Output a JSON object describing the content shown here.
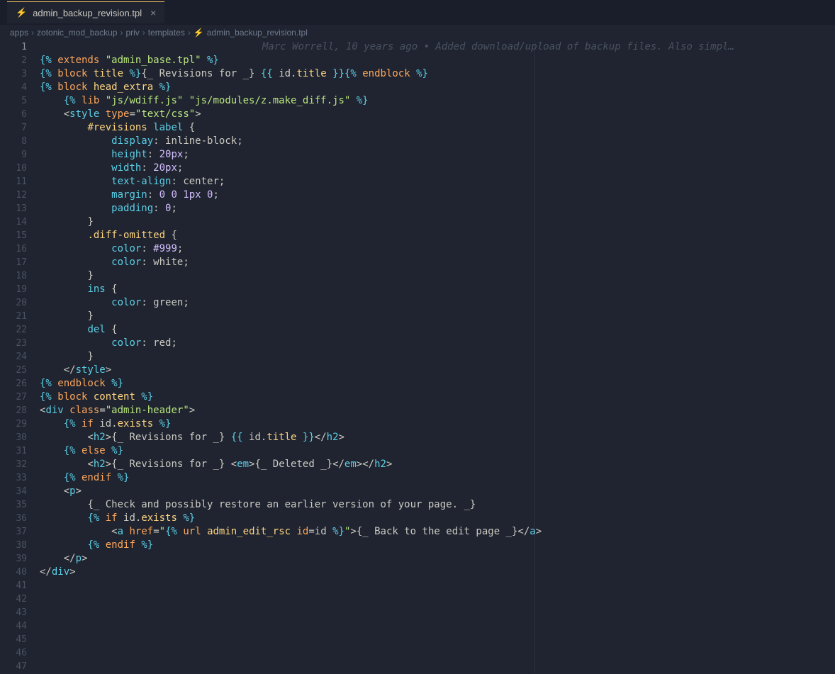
{
  "tab": {
    "filename": "admin_backup_revision.tpl"
  },
  "breadcrumbs": {
    "items": [
      "apps",
      "zotonic_mod_backup",
      "priv",
      "templates",
      "admin_backup_revision.tpl"
    ]
  },
  "blame": "Marc Worrell, 10 years ago • Added download/upload of backup files. Also simpl…",
  "lines": {
    "count": 47,
    "current": 1
  },
  "code": {
    "l1": {
      "p1": "{%",
      "p2": " extends ",
      "p3": "\"admin_base.tpl\"",
      "p4": " %}"
    },
    "l3": {
      "p1": "{%",
      "p2": " block",
      "p3": " title ",
      "p4": "%}",
      "p5": "{_ Revisions for _}",
      "p6": " {{ ",
      "p7": "id",
      "p8": ".",
      "p9": "title",
      "p10": " }}",
      "p11": "{%",
      "p12": " endblock ",
      "p13": "%}"
    },
    "l5": {
      "p1": "{%",
      "p2": " block",
      "p3": " head_extra ",
      "p4": "%}"
    },
    "l6": {
      "indent": "    ",
      "p1": "{%",
      "p2": " lib ",
      "p3": "\"js/wdiff.js\"",
      "p4": " ",
      "p5": "\"js/modules/z.make_diff.js\"",
      "p6": " %}"
    },
    "l8": {
      "indent": "    ",
      "p1": "<",
      "p2": "style",
      "p3": " type",
      "p4": "=",
      "p5": "\"text/css\"",
      "p6": ">"
    },
    "l9": {
      "indent": "        ",
      "p1": "#revisions",
      "p2": " label",
      "p3": " {"
    },
    "l10": {
      "indent": "            ",
      "p1": "display",
      "p2": ": ",
      "p3": "inline-block",
      "p4": ";"
    },
    "l11": {
      "indent": "            ",
      "p1": "height",
      "p2": ": ",
      "p3": "20px",
      "p4": ";"
    },
    "l12": {
      "indent": "            ",
      "p1": "width",
      "p2": ": ",
      "p3": "20px",
      "p4": ";"
    },
    "l13": {
      "indent": "            ",
      "p1": "text-align",
      "p2": ": ",
      "p3": "center",
      "p4": ";"
    },
    "l14": {
      "indent": "            ",
      "p1": "margin",
      "p2": ": ",
      "p3": "0 0 1px 0",
      "p4": ";"
    },
    "l15": {
      "indent": "            ",
      "p1": "padding",
      "p2": ": ",
      "p3": "0",
      "p4": ";"
    },
    "l16": {
      "indent": "        ",
      "p1": "}"
    },
    "l17": {
      "indent": "        ",
      "p1": ".diff-omitted",
      "p2": " {"
    },
    "l18": {
      "indent": "            ",
      "p1": "color",
      "p2": ": ",
      "p3": "#999",
      "p4": ";"
    },
    "l19": {
      "indent": "            ",
      "p1": "color",
      "p2": ": ",
      "p3": "white",
      "p4": ";"
    },
    "l20": {
      "indent": "        ",
      "p1": "}"
    },
    "l21": {
      "indent": "        ",
      "p1": "ins",
      "p2": " {"
    },
    "l22": {
      "indent": "            ",
      "p1": "color",
      "p2": ": ",
      "p3": "green",
      "p4": ";"
    },
    "l23": {
      "indent": "        ",
      "p1": "}"
    },
    "l24": {
      "indent": "        ",
      "p1": "del",
      "p2": " {"
    },
    "l25": {
      "indent": "            ",
      "p1": "color",
      "p2": ": ",
      "p3": "red",
      "p4": ";"
    },
    "l26": {
      "indent": "        ",
      "p1": "}"
    },
    "l27": {
      "indent": "    ",
      "p1": "</",
      "p2": "style",
      "p3": ">"
    },
    "l28": {
      "p1": "{%",
      "p2": " endblock ",
      "p3": "%}"
    },
    "l31": {
      "p1": "{%",
      "p2": " block",
      "p3": " content ",
      "p4": "%}"
    },
    "l33": {
      "p1": "<",
      "p2": "div",
      "p3": " class",
      "p4": "=",
      "p5": "\"admin-header\"",
      "p6": ">"
    },
    "l35": {
      "indent": "    ",
      "p1": "{%",
      "p2": " if",
      "p3": " id",
      "p4": ".",
      "p5": "exists",
      "p6": " %}"
    },
    "l36": {
      "indent": "        ",
      "p1": "<",
      "p2": "h2",
      "p3": ">",
      "p4": "{_ Revisions for _}",
      "p5": " {{ ",
      "p6": "id",
      "p7": ".",
      "p8": "title",
      "p9": " }}",
      "p10": "</",
      "p11": "h2",
      "p12": ">"
    },
    "l37": {
      "indent": "    ",
      "p1": "{%",
      "p2": " else ",
      "p3": "%}"
    },
    "l38": {
      "indent": "        ",
      "p1": "<",
      "p2": "h2",
      "p3": ">",
      "p4": "{_ Revisions for _}",
      "p5": " <",
      "p6": "em",
      "p7": ">",
      "p8": "{_ Deleted _}",
      "p9": "</",
      "p10": "em",
      "p11": ">",
      "p12": "</",
      "p13": "h2",
      "p14": ">"
    },
    "l39": {
      "indent": "    ",
      "p1": "{%",
      "p2": " endif ",
      "p3": "%}"
    },
    "l41": {
      "indent": "    ",
      "p1": "<",
      "p2": "p",
      "p3": ">"
    },
    "l42": {
      "indent": "        ",
      "p1": "{_ Check and possibly restore an earlier version of your page. _}"
    },
    "l43": {
      "indent": "        ",
      "p1": "{%",
      "p2": " if",
      "p3": " id",
      "p4": ".",
      "p5": "exists",
      "p6": " %}"
    },
    "l44": {
      "indent": "            ",
      "p1": "<",
      "p2": "a",
      "p3": " href",
      "p4": "=",
      "p5": "\"",
      "p6": "{%",
      "p7": " url",
      "p8": " admin_edit_rsc ",
      "p9": "id",
      "p10": "=",
      "p11": "id",
      "p12": " %}",
      "p13": "\"",
      "p14": ">",
      "p15": "{_ Back to the edit page _}",
      "p16": "</",
      "p17": "a",
      "p18": ">"
    },
    "l45": {
      "indent": "        ",
      "p1": "{%",
      "p2": " endif ",
      "p3": "%}"
    },
    "l46": {
      "indent": "    ",
      "p1": "</",
      "p2": "p",
      "p3": ">"
    },
    "l47": {
      "p1": "</",
      "p2": "div",
      "p3": ">"
    }
  }
}
